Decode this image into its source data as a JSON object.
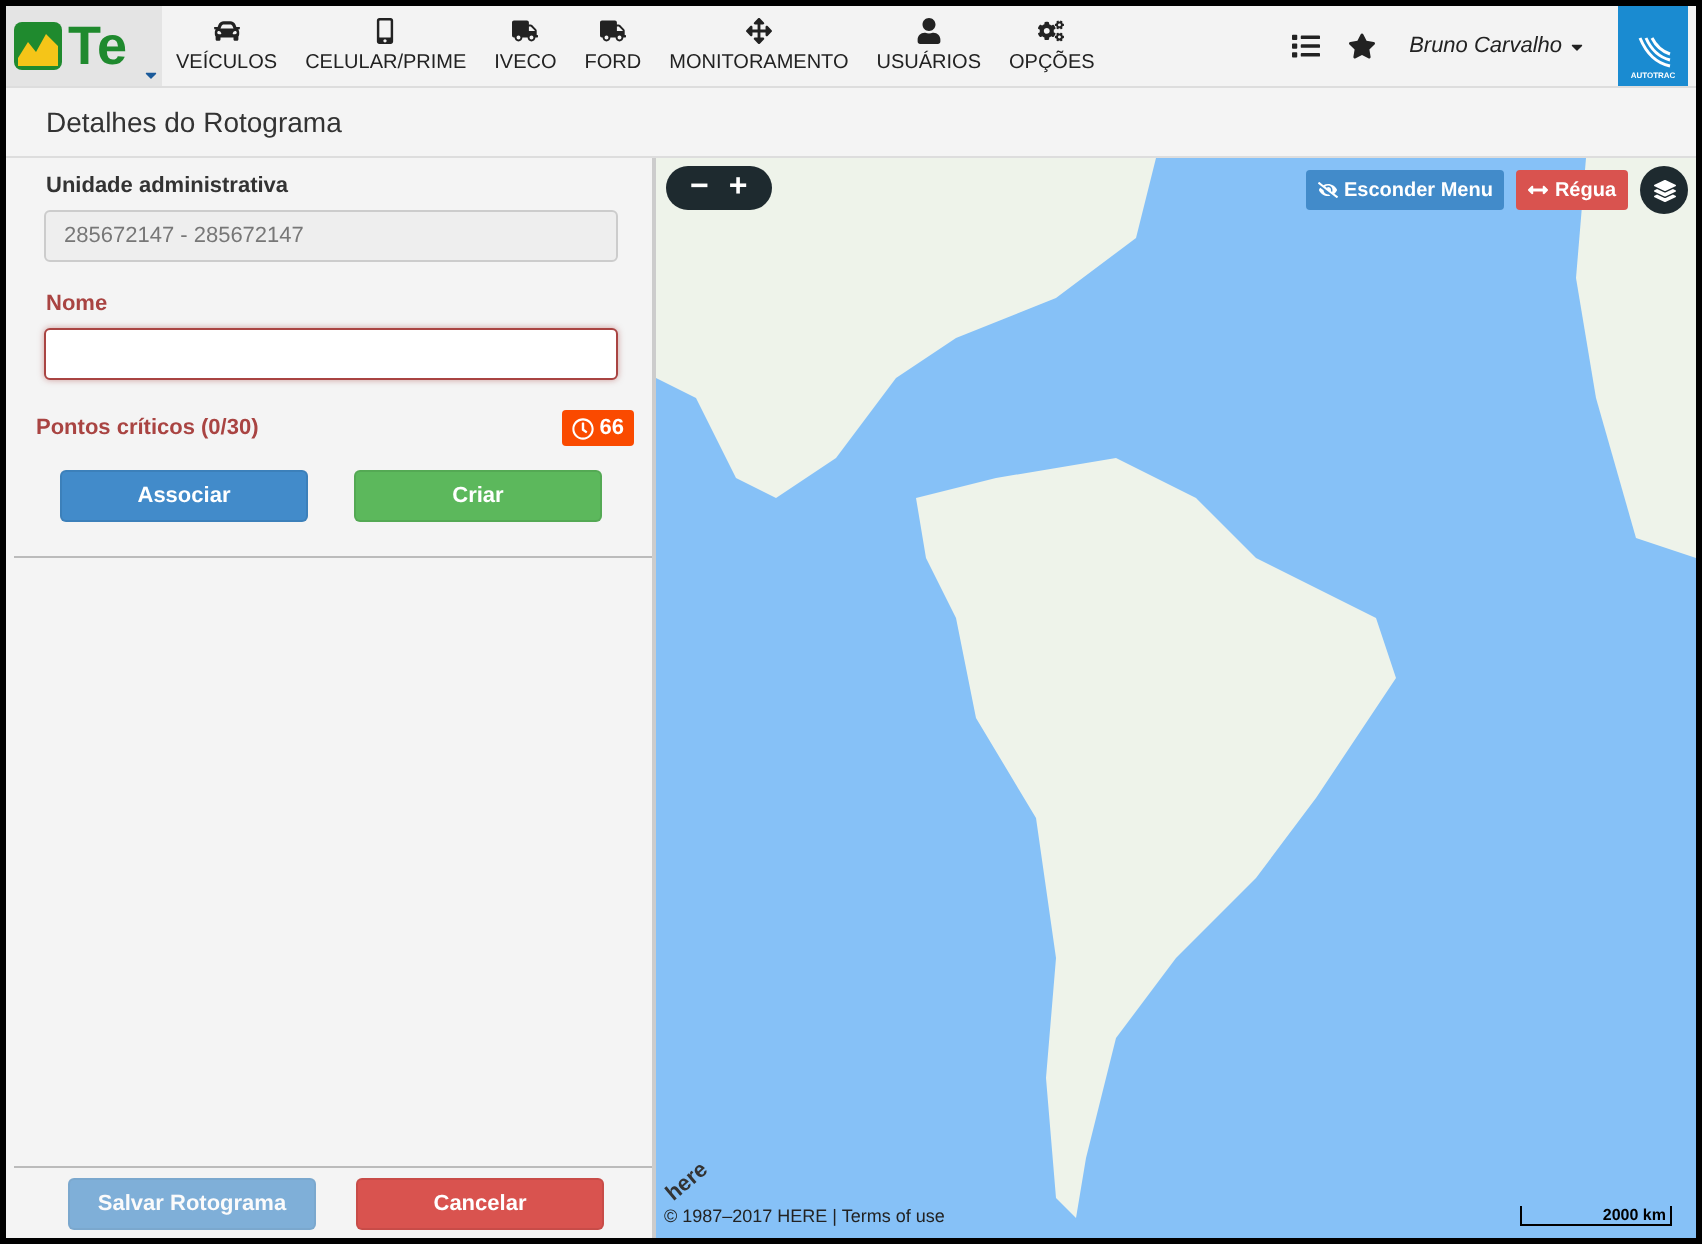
{
  "logo": {
    "text": "Te"
  },
  "nav": [
    {
      "label": "VEÍCULOS",
      "kind": "car"
    },
    {
      "label": "CELULAR/PRIME",
      "kind": "mobile"
    },
    {
      "label": "IVECO",
      "kind": "truck"
    },
    {
      "label": "FORD",
      "kind": "truck"
    },
    {
      "label": "MONITORAMENTO",
      "kind": "move"
    },
    {
      "label": "USUÁRIOS",
      "kind": "user"
    },
    {
      "label": "OPÇÕES",
      "kind": "cogs"
    }
  ],
  "user": {
    "name": "Bruno Carvalho"
  },
  "brand": {
    "text": "AUTOTRAC"
  },
  "page_title": "Detalhes do Rotograma",
  "form": {
    "unit": {
      "label": "Unidade administrativa",
      "value": "285672147 - 285672147",
      "disabled": true
    },
    "name": {
      "label": "Nome",
      "error": true
    },
    "points": {
      "label": "Pontos críticos (0/30)",
      "badge": "66"
    },
    "actions": [
      {
        "label": "Associar",
        "kind": "primary",
        "disabled": false
      },
      {
        "label": "Criar",
        "kind": "success",
        "disabled": false
      }
    ],
    "footer": [
      {
        "label": "Salvar Rotograma",
        "kind": "primary",
        "disabled": true
      },
      {
        "label": "Cancelar",
        "kind": "danger",
        "disabled": false
      }
    ]
  },
  "map": {
    "zoom": [
      "−",
      "+"
    ],
    "buttons": [
      {
        "label": "Esconder Menu",
        "kind": "primary"
      },
      {
        "label": "Régua",
        "kind": "danger"
      }
    ],
    "logo": "here",
    "copyright": "© 1987–2017 HERE | Terms of use",
    "scale": "2000 km"
  }
}
